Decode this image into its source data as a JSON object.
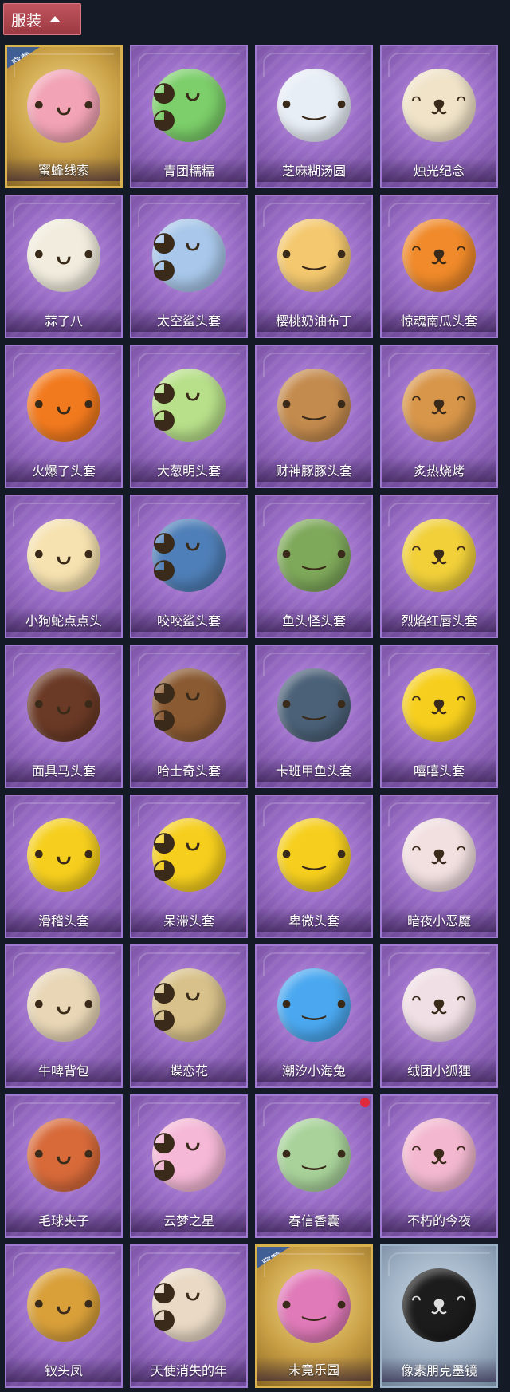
{
  "header": {
    "title": "服装"
  },
  "worn_badge": "穿戴",
  "items": [
    {
      "label": "蜜蜂线索",
      "color": "#f2a3b5",
      "icon": "bee-bear-icon",
      "frame": "gold",
      "worn": true
    },
    {
      "label": "青团糯糯",
      "color": "#7ccf6a",
      "icon": "green-dumpling-icon"
    },
    {
      "label": "芝麻糊汤圆",
      "color": "#e8eef6",
      "icon": "rice-ball-icon"
    },
    {
      "label": "烛光纪念",
      "color": "#f0e3c8",
      "icon": "candle-icon"
    },
    {
      "label": "蒜了八",
      "color": "#f1ecdd",
      "icon": "garlic-icon"
    },
    {
      "label": "太空鲨头套",
      "color": "#a8c7ea",
      "icon": "space-shark-icon"
    },
    {
      "label": "樱桃奶油布丁",
      "color": "#f4c86e",
      "icon": "pudding-icon"
    },
    {
      "label": "惊魂南瓜头套",
      "color": "#f08a2a",
      "icon": "pumpkin-icon"
    },
    {
      "label": "火爆了头套",
      "color": "#f27a1e",
      "icon": "fire-icon"
    },
    {
      "label": "大葱明头套",
      "color": "#b8e08a",
      "icon": "scallion-icon"
    },
    {
      "label": "财神豚豚头套",
      "color": "#c48b4e",
      "icon": "capybara-icon"
    },
    {
      "label": "炙热烧烤",
      "color": "#d8964a",
      "icon": "bbq-icon"
    },
    {
      "label": "小狗蛇点点头",
      "color": "#f6e2b0",
      "icon": "snake-dog-icon"
    },
    {
      "label": "咬咬鲨头套",
      "color": "#4f7fb8",
      "icon": "shark-bite-icon"
    },
    {
      "label": "鱼头怪头套",
      "color": "#7ea85a",
      "icon": "fish-head-icon"
    },
    {
      "label": "烈焰红唇头套",
      "color": "#f1d03a",
      "icon": "pikachu-icon"
    },
    {
      "label": "面具马头套",
      "color": "#6b3a26",
      "icon": "horse-mask-icon"
    },
    {
      "label": "哈士奇头套",
      "color": "#8a5a32",
      "icon": "husky-icon"
    },
    {
      "label": "卡班甲鱼头套",
      "color": "#4b6178",
      "icon": "whale-icon"
    },
    {
      "label": "嘻嘻头套",
      "color": "#f6cf1e",
      "icon": "grin-emoji-icon"
    },
    {
      "label": "滑稽头套",
      "color": "#f6cf1e",
      "icon": "funny-emoji-icon"
    },
    {
      "label": "呆滞头套",
      "color": "#f6cf1e",
      "icon": "stunned-emoji-icon"
    },
    {
      "label": "卑微头套",
      "color": "#f6cf1e",
      "icon": "humble-emoji-icon"
    },
    {
      "label": "暗夜小恶魔",
      "color": "#f2dfe0",
      "icon": "little-devil-icon"
    },
    {
      "label": "牛啤背包",
      "color": "#e8d6b6",
      "icon": "beer-cow-icon"
    },
    {
      "label": "蝶恋花",
      "color": "#d8c18a",
      "icon": "butterfly-flower-icon"
    },
    {
      "label": "潮汐小海兔",
      "color": "#4ba8f0",
      "icon": "sea-bunny-icon"
    },
    {
      "label": "绒团小狐狸",
      "color": "#f0dfe4",
      "icon": "fox-icon"
    },
    {
      "label": "毛球夹子",
      "color": "#d86a3a",
      "icon": "nutcracker-icon"
    },
    {
      "label": "云梦之星",
      "color": "#f5b8d6",
      "icon": "star-unicorn-icon"
    },
    {
      "label": "春信香囊",
      "color": "#a8d29a",
      "icon": "sachet-icon",
      "dot": true
    },
    {
      "label": "不朽的今夜",
      "color": "#f3b8cf",
      "icon": "pink-fox-icon"
    },
    {
      "label": "钗头凤",
      "color": "#d9a03a",
      "icon": "phoenix-crown-icon"
    },
    {
      "label": "天使消失的年",
      "color": "#e9d9c5",
      "icon": "angel-icon"
    },
    {
      "label": "未竟乐园",
      "color": "#e07ab8",
      "icon": "paradise-girl-icon",
      "frame": "gold",
      "worn": true
    },
    {
      "label": "像素朋克墨镜",
      "color": "#1c1c1c",
      "icon": "pixel-sunglasses-icon",
      "frame": "blue"
    }
  ]
}
